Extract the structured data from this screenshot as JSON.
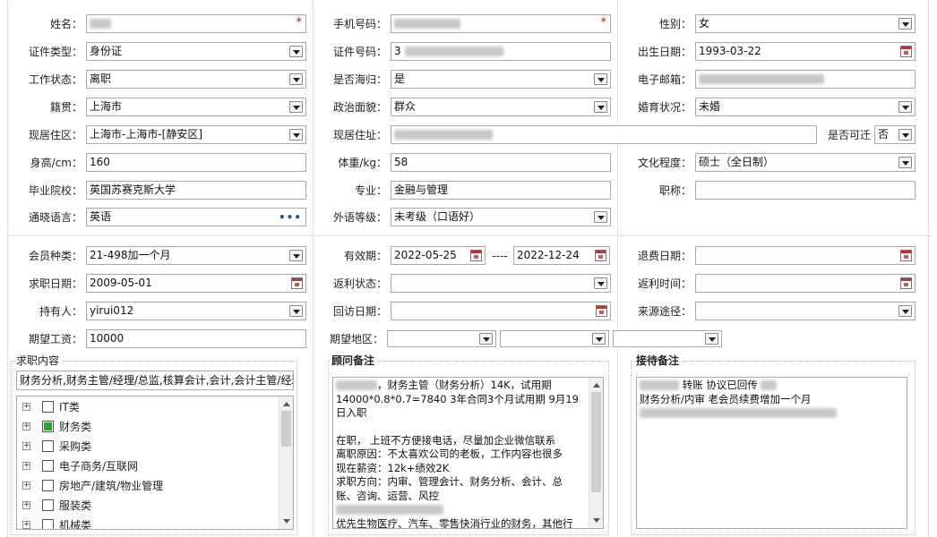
{
  "personal": {
    "name_label": "姓名：",
    "mobile_label": "手机号码：",
    "gender_label": "性别：",
    "gender_value": "女",
    "id_type_label": "证件类型：",
    "id_type_value": "身份证",
    "id_number_label": "证件号码：",
    "id_number_value": "3",
    "birth_label": "出生日期：",
    "birth_value": "1993-03-22",
    "work_status_label": "工作状态：",
    "work_status_value": "离职",
    "returnee_label": "是否海归：",
    "returnee_value": "是",
    "email_label": "电子邮箱：",
    "native_label": "籍贯：",
    "native_value": "上海市",
    "political_label": "政治面貌：",
    "political_value": "群众",
    "marital_label": "婚育状况：",
    "marital_value": "未婚",
    "residence_area_label": "现居住区：",
    "residence_area_value": "上海市-上海市-[静安区]",
    "address_label": "现居住址：",
    "relocate_label": "是否可迁",
    "relocate_value": "否",
    "height_label": "身高/cm：",
    "height_value": "160",
    "weight_label": "体重/kg：",
    "weight_value": "58",
    "education_label": "文化程度：",
    "education_value": "硕士（全日制）",
    "school_label": "毕业院校：",
    "school_value": "英国苏赛克斯大学",
    "major_label": "专业：",
    "major_value": "金融与管理",
    "title_label": "职称：",
    "title_value": "",
    "language_label": "通晓语言：",
    "language_value": "英语",
    "language_more": "•••",
    "lang_level_label": "外语等级：",
    "lang_level_value": "未考级（口语好）"
  },
  "membership": {
    "type_label": "会员种类：",
    "type_value": "21-498加一个月",
    "valid_label": "有效期：",
    "valid_from": "2022-05-25",
    "valid_sep": "----",
    "valid_to": "2022-12-24",
    "refund_date_label": "退费日期：",
    "job_date_label": "求职日期：",
    "job_date_value": "2009-05-01",
    "rebate_status_label": "返利状态：",
    "rebate_time_label": "返利时间：",
    "holder_label": "持有人：",
    "holder_value": "yirui012",
    "visit_date_label": "回访日期：",
    "source_label": "来源途径：",
    "salary_label": "期望工资：",
    "salary_value": "10000",
    "region_label": "期望地区："
  },
  "job_content": {
    "title": "求职内容",
    "selected_text": "财务分析,财务主管/经理/总监,核算会计,会计,会计主管/经理",
    "tree": [
      {
        "label": "IT类",
        "checked": false
      },
      {
        "label": "财务类",
        "checked": true
      },
      {
        "label": "采购类",
        "checked": false
      },
      {
        "label": "电子商务/互联网",
        "checked": false
      },
      {
        "label": "房地产/建筑/物业管理",
        "checked": false
      },
      {
        "label": "服装类",
        "checked": false
      },
      {
        "label": "机械类",
        "checked": false
      }
    ]
  },
  "advisor_notes": {
    "title": "顾问备注",
    "line1": "，财务主管（财务分析）14K，试用期",
    "line2": "14000*0.8*0.7=7840  3年合同3个月试用期  9月19",
    "line3": "日入职",
    "line4": "在职， 上班不方便接电话，尽量加企业微信联系",
    "line5": "离职原因：不太喜欢公司的老板，工作内容也很多",
    "line6": "现在薪资：12k+绩效2K",
    "line7": "求职方向：内审、管理会计、财务分析、会计、总",
    "line8": "账、咨询、运营、风控",
    "line9": "优先生物医疗、汽车、零售快消行业的财务，其他行"
  },
  "reception_notes": {
    "title": "接待备注",
    "line1": "转账 协议已回传",
    "line2": "财务分析/内审  老会员续费增加一个月"
  },
  "colors": {
    "required": "#ee0000",
    "checked": "#2ea52e",
    "field_border": "#a9a9a9"
  }
}
